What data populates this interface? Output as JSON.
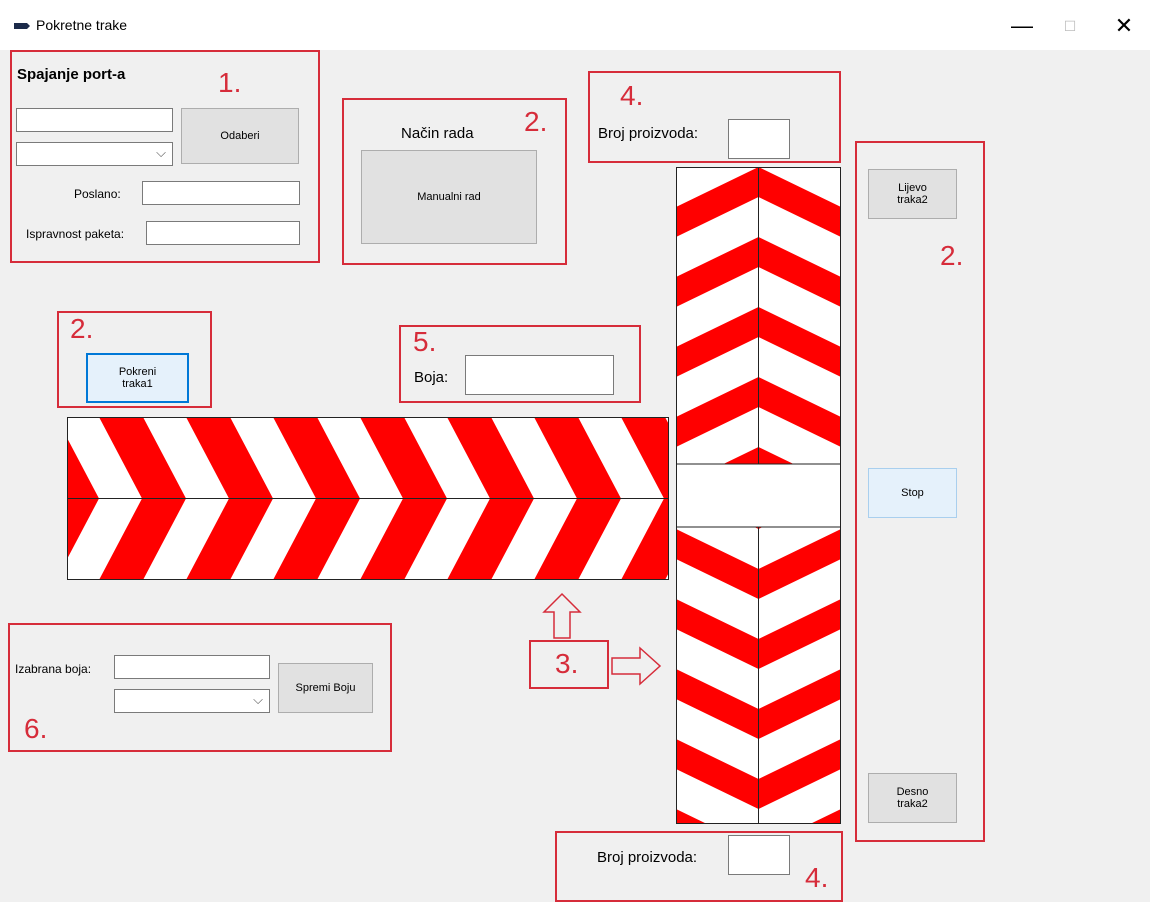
{
  "window": {
    "title": "Pokretne trake",
    "minimize": "—",
    "maximize": "☐",
    "close": "✕"
  },
  "section1": {
    "number": "1.",
    "heading": "Spajanje port-a",
    "select_button": "Odaberi",
    "sent_label": "Poslano:",
    "sent_value": "",
    "packet_label": "Ispravnost paketa:",
    "packet_value": "",
    "port_input": "",
    "port_combo": ""
  },
  "mode": {
    "number": "2.",
    "label": "Način rada",
    "button": "Manualni rad"
  },
  "top_counter": {
    "number": "4.",
    "label": "Broj proizvoda:",
    "value": ""
  },
  "right_controls": {
    "number": "2.",
    "left_button": [
      "Lijevo",
      "traka2"
    ],
    "stop_button": "Stop",
    "right_button": [
      "Desno",
      "traka2"
    ]
  },
  "start_belt": {
    "number": "2.",
    "button": [
      "Pokreni",
      "traka1"
    ]
  },
  "color_box": {
    "number": "5.",
    "label": "Boja:",
    "value": ""
  },
  "belt_annotation": {
    "number": "3."
  },
  "section6": {
    "number": "6.",
    "label": "Izabrana boja:",
    "value": "",
    "combo": "",
    "save_button": "Spremi Boju"
  },
  "bottom_counter": {
    "number": "4.",
    "label": "Broj proizvoda:",
    "value": ""
  },
  "icons": {
    "chevron": "⌵"
  },
  "colors": {
    "annotation": "#d62c3a",
    "belt_red": "#ff0000",
    "belt_white": "#ffffff"
  }
}
